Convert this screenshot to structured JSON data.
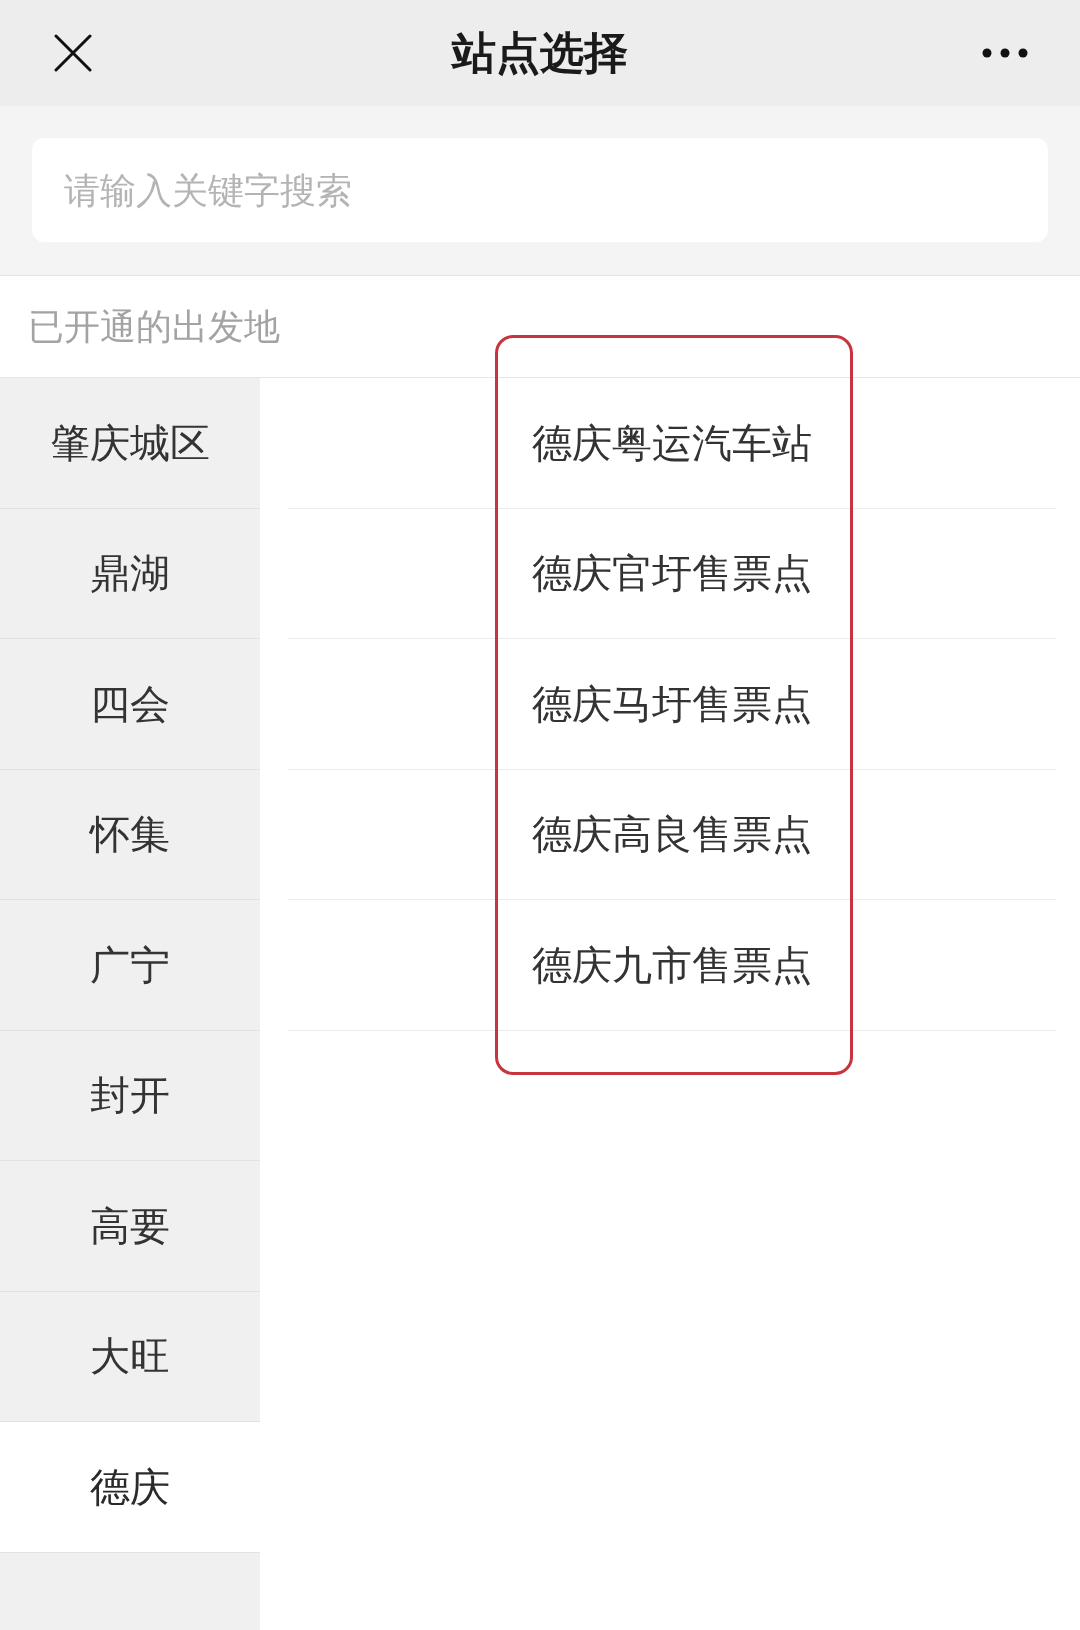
{
  "header": {
    "title": "站点选择"
  },
  "search": {
    "placeholder": "请输入关键字搜索"
  },
  "section_label": "已开通的出发地",
  "regions": [
    {
      "label": "肇庆城区",
      "selected": false
    },
    {
      "label": "鼎湖",
      "selected": false
    },
    {
      "label": "四会",
      "selected": false
    },
    {
      "label": "怀集",
      "selected": false
    },
    {
      "label": "广宁",
      "selected": false
    },
    {
      "label": "封开",
      "selected": false
    },
    {
      "label": "高要",
      "selected": false
    },
    {
      "label": "大旺",
      "selected": false
    },
    {
      "label": "德庆",
      "selected": true
    }
  ],
  "stations": [
    "德庆粤运汽车站",
    "德庆官圩售票点",
    "德庆马圩售票点",
    "德庆高良售票点",
    "德庆九市售票点"
  ]
}
